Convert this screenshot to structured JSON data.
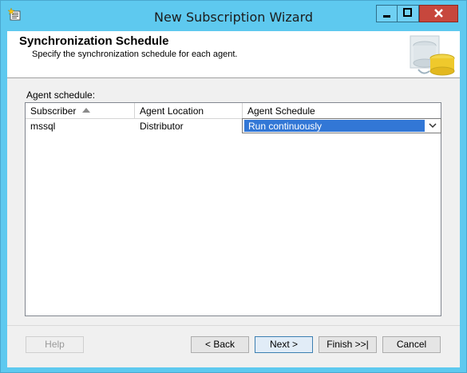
{
  "window": {
    "title": "New Subscription Wizard"
  },
  "header": {
    "title": "Synchronization Schedule",
    "subtitle": "Specify the synchronization schedule for each agent."
  },
  "agent_schedule": {
    "label": "Agent schedule:",
    "columns": [
      "Subscriber",
      "Agent Location",
      "Agent Schedule"
    ],
    "rows": [
      {
        "subscriber": "mssql",
        "location": "Distributor",
        "schedule": "Run continuously"
      }
    ]
  },
  "buttons": {
    "help": "Help",
    "back": "< Back",
    "next": "Next >",
    "finish": "Finish >>|",
    "cancel": "Cancel"
  }
}
